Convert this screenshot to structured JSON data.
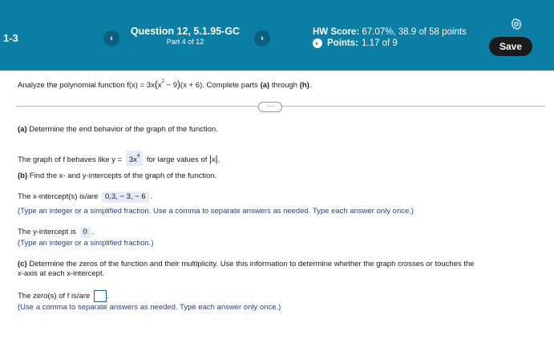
{
  "header": {
    "section": "1-3",
    "question_title": "Question 12, 5.1.95-GC",
    "question_part": "Part 4 of 12",
    "hw_score_label": "HW Score:",
    "hw_score_value": "67.07%, 38.9 of 58 points",
    "points_label": "Points:",
    "points_value": "1.17 of 9",
    "save_label": "Save",
    "prev_symbol": "‹",
    "next_symbol": "›"
  },
  "intro": {
    "pre": "Analyze the polynomial function f(x) = 3x",
    "x": "x",
    "exp": "2",
    "mid": " − 9",
    "post": "(x + 6). Complete parts ",
    "part_a": "(a)",
    "through": " through ",
    "part_h": "(h)",
    "end": "."
  },
  "more_button": "···",
  "part_a": {
    "label": "(a)",
    "question": " Determine the end behavior of the graph of the function.",
    "answer_pre": "The graph of f behaves like y = ",
    "answer_base": "3x",
    "answer_exp": "4",
    "answer_post": " for large values of ",
    "abs_x": "x",
    "period": "."
  },
  "part_b": {
    "label": "(b)",
    "question": " Find the x- and y-intercepts of the graph of the function.",
    "x_int_pre": "The x-intercept(s) is/are ",
    "x_int_value": "0,3, − 3, − 6",
    "x_int_post": ".",
    "x_hint": "(Type an integer or a simplified fraction. Use a comma to separate answers as needed. Type each answer only once.)",
    "y_int_pre": "The y-intercept is ",
    "y_int_value": "0",
    "y_int_post": ".",
    "y_hint": "(Type an integer or a simplified fraction.)"
  },
  "part_c": {
    "label": "(c)",
    "question_line1": " Determine the zeros of the function and their multiplicity. Use this information to determine whether the graph crosses or touches the",
    "question_line2": "x-axis at each x-intercept.",
    "zeros_pre": "The zero(s) of f is/are ",
    "zeros_post": ".",
    "zeros_hint": "(Use a comma to separate answers as needed. Type each answer only once.)"
  }
}
